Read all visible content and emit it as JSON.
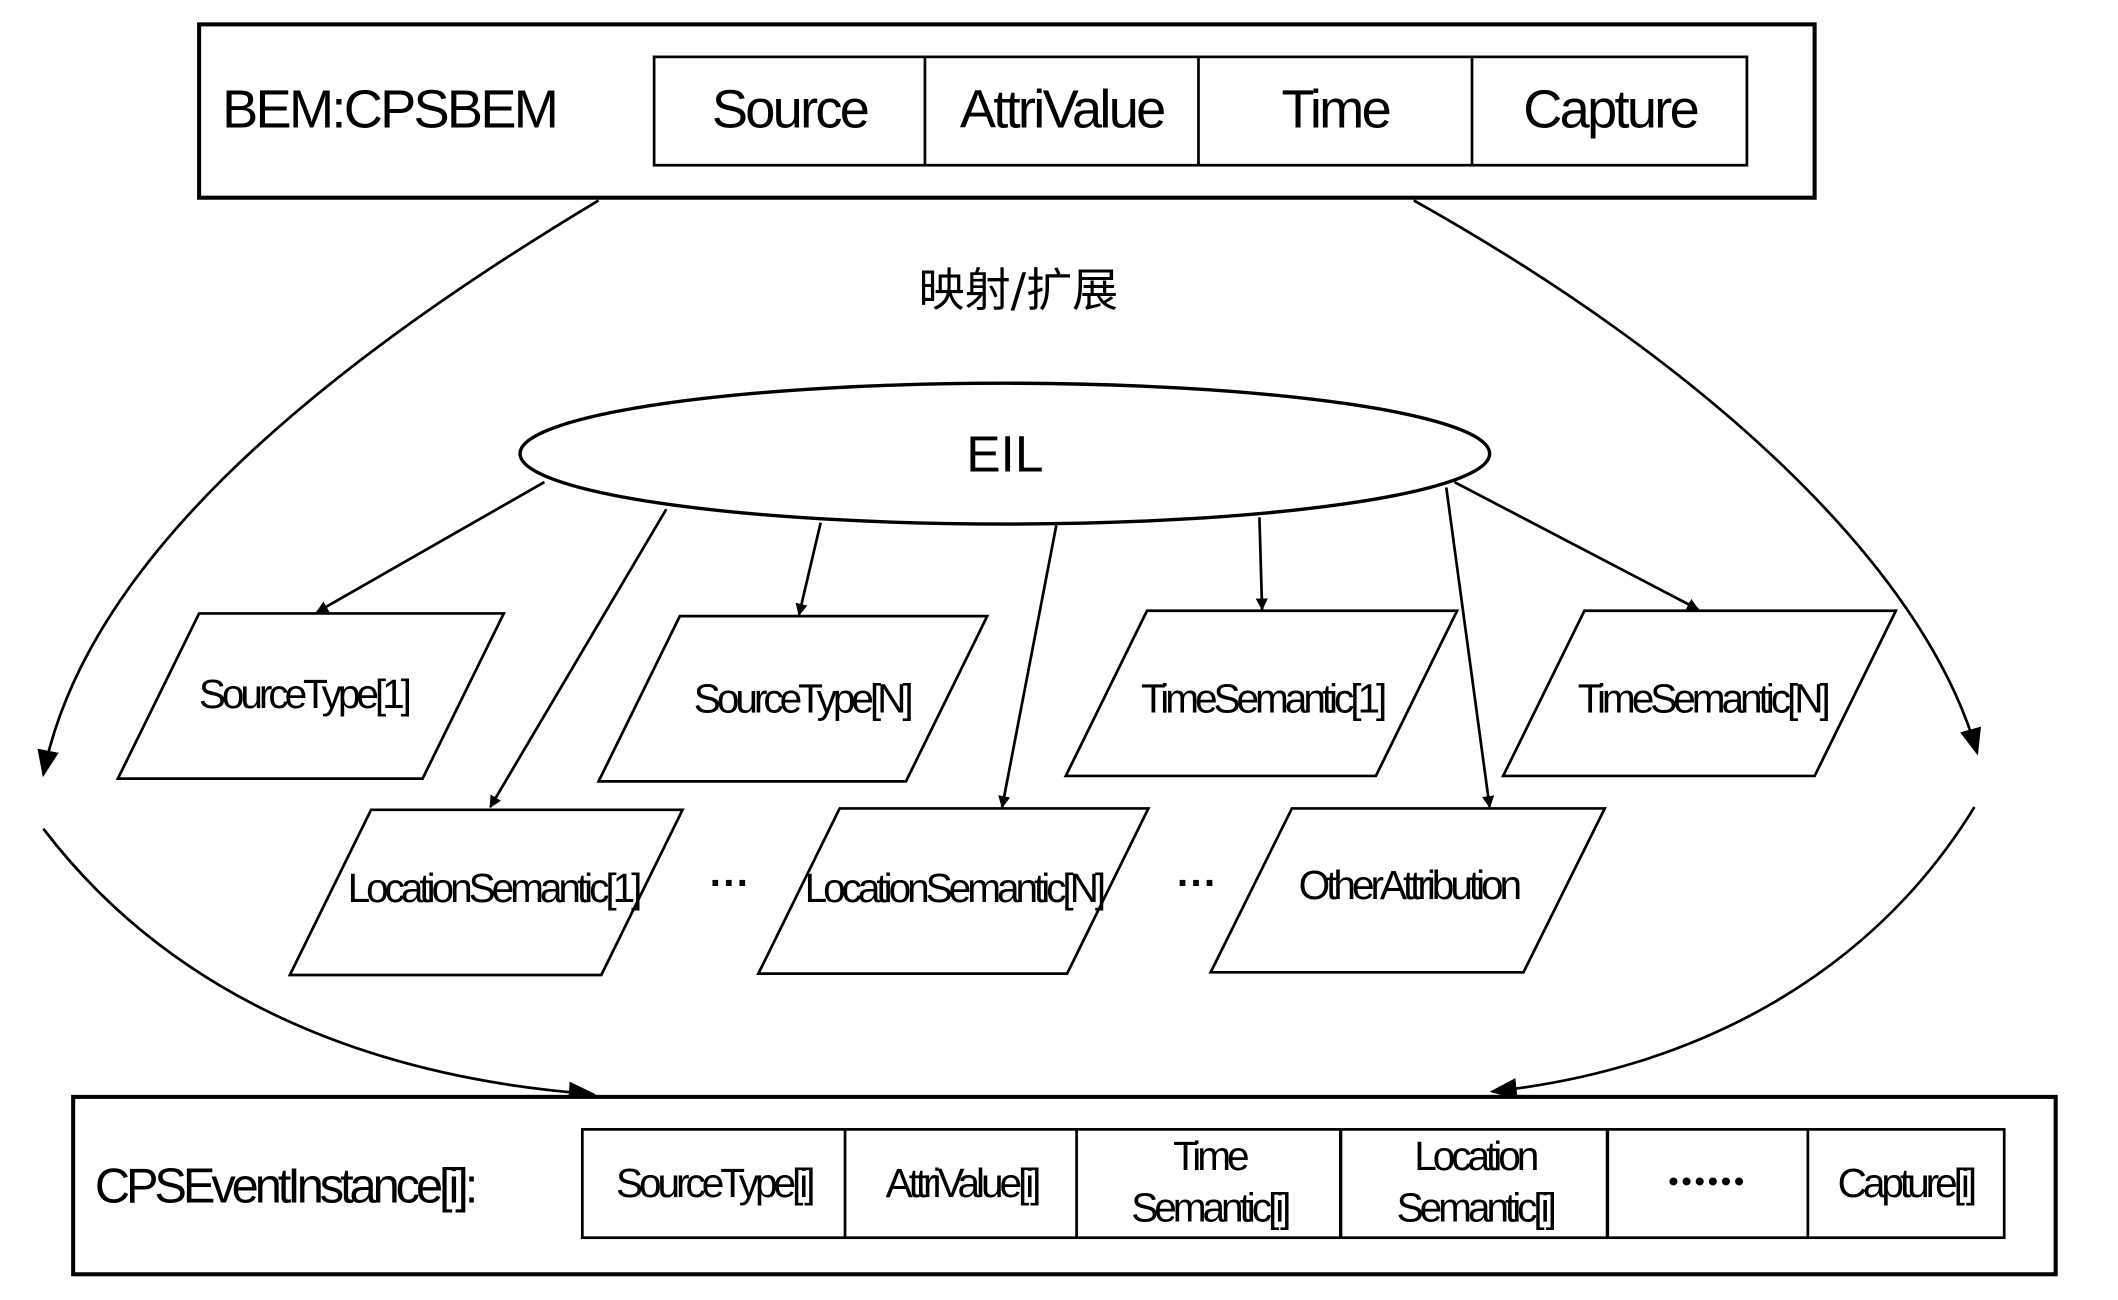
{
  "top_box": {
    "title": "BEM:CPSBEM",
    "fields": [
      "Source",
      "AttriValue",
      "Time",
      "Capture"
    ]
  },
  "mapping_label": "映射/扩展",
  "eil": {
    "label": "EIL"
  },
  "row1": [
    "SourceType[1]",
    "SourceType[N]",
    "TimeSemantic[1]",
    "TimeSemantic[N]"
  ],
  "row2": [
    "LocationSemantic[1]",
    "LocationSemantic[N]",
    "OtherAttribution"
  ],
  "row2_ellipses": [
    "···",
    "···"
  ],
  "bottom_box": {
    "title": "CPSEventInstance[i]:",
    "fields": [
      {
        "line1": "SourceType[i]",
        "line2": ""
      },
      {
        "line1": "AttriValue[i]",
        "line2": ""
      },
      {
        "line1": "Time",
        "line2": "Semantic[i]"
      },
      {
        "line1": "Location",
        "line2": "Semantic[i]"
      },
      {
        "line1": "••••••",
        "line2": ""
      },
      {
        "line1": "Capture[i]",
        "line2": ""
      }
    ]
  }
}
